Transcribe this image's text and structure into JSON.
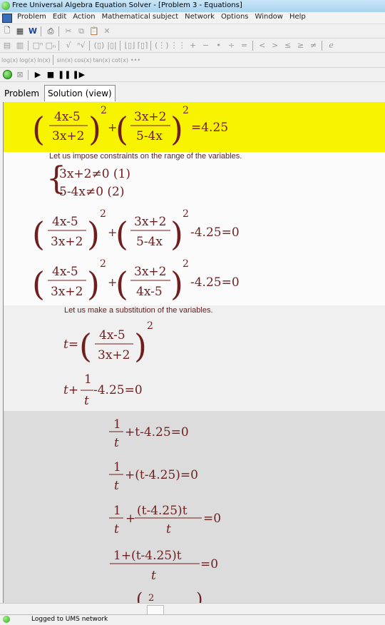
{
  "window": {
    "title": "Free Universal Algebra Equation Solver - [Problem 3 - Equations]"
  },
  "menu": [
    "Problem",
    "Edit",
    "Action",
    "Mathematical subject",
    "Network",
    "Options",
    "Window",
    "Help"
  ],
  "toolbar2_symbols": [
    "+",
    "−",
    "•",
    "÷",
    "=",
    "<",
    ">",
    "≤",
    "≥",
    "≠",
    "e"
  ],
  "toolbar3_functions": [
    "log(x)",
    "log(x)",
    "ln(x)",
    "sin(x)",
    "cos(x)",
    "tan(x)",
    "cot(x)",
    "•••"
  ],
  "tabs": {
    "problem": "Problem",
    "solution": "Solution (view)"
  },
  "captions": {
    "constraints": "Let us impose constraints on the range of the variables.",
    "substitution": "Let us make a substitution of the variables."
  },
  "math": {
    "eq0_rhs": "=4.25",
    "frac_a_num": "4x-5",
    "frac_a_den": "3x+2",
    "frac_b_num": "3x+2",
    "frac_b_den": "5-4x",
    "frac_b_den_alt": "4x-5",
    "exp": "2",
    "c1": "3x+2≠0 (1)",
    "c2": "5-4x≠0 (2)",
    "minus_rhs": "-4.25=0",
    "t_def_lhs": "t=",
    "t_eq_a": "t+",
    "t_eq_rhs": "-4.25=0",
    "one": "1",
    "t": "t",
    "l1_rest": "+t-4.25=0",
    "l2_rest": "+(t-4.25)=0",
    "l3_num": "(t-4.25)t",
    "l3_rhs": "=0",
    "l4_num": "1+(t-4.25)t",
    "l4_rhs": "=0",
    "plus": "+"
  },
  "status": {
    "text": "Logged to UMS network"
  },
  "colors": {
    "highlight": "#f8f400",
    "math": "#6e1e1e"
  }
}
